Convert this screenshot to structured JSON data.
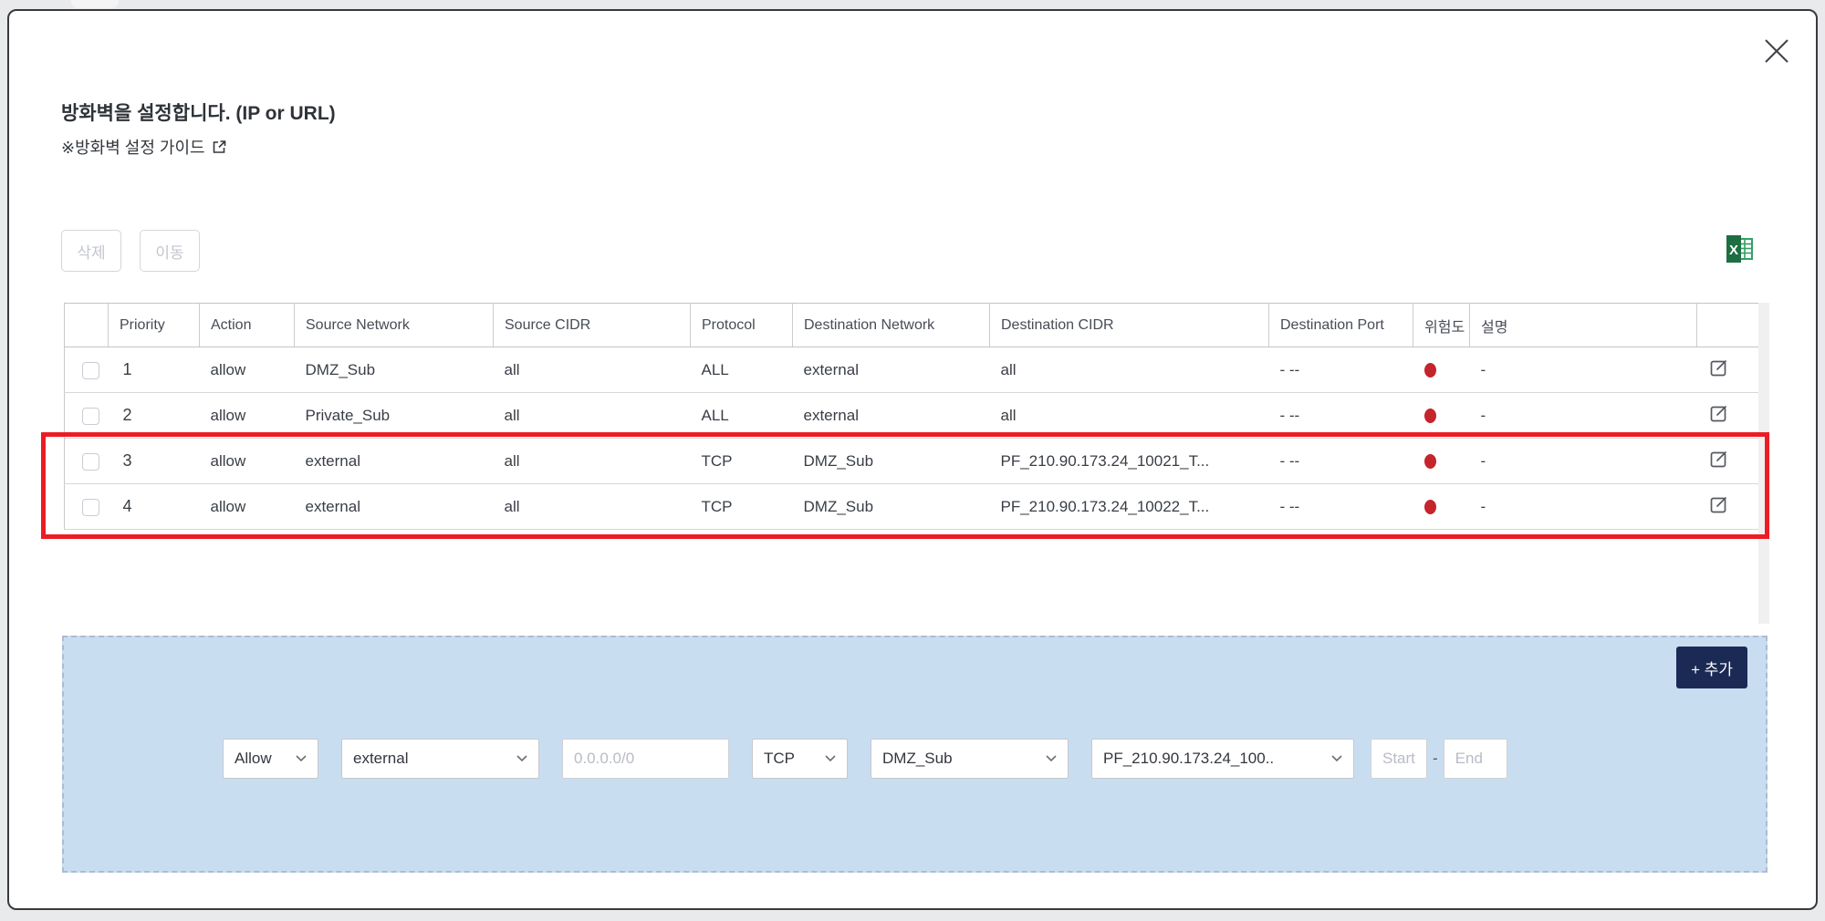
{
  "modal": {
    "title": "방화벽을 설정합니다. (IP or URL)",
    "guide_link": "※방화벽 설정 가이드"
  },
  "toolbar": {
    "delete_label": "삭제",
    "move_label": "이동"
  },
  "table": {
    "columns": [
      "Priority",
      "Action",
      "Source Network",
      "Source CIDR",
      "Protocol",
      "Destination Network",
      "Destination CIDR",
      "Destination Port",
      "위험도",
      "설명"
    ],
    "rows": [
      {
        "priority": "1",
        "action": "allow",
        "source_network": "DMZ_Sub",
        "source_cidr": "all",
        "protocol": "ALL",
        "destination_network": "external",
        "destination_cidr": "all",
        "destination_port": "- --",
        "risk": "red-dot",
        "description": "-"
      },
      {
        "priority": "2",
        "action": "allow",
        "source_network": "Private_Sub",
        "source_cidr": "all",
        "protocol": "ALL",
        "destination_network": "external",
        "destination_cidr": "all",
        "destination_port": "- --",
        "risk": "red-dot",
        "description": "-"
      },
      {
        "priority": "3",
        "action": "allow",
        "source_network": "external",
        "source_cidr": "all",
        "protocol": "TCP",
        "destination_network": "DMZ_Sub",
        "destination_cidr": "PF_210.90.173.24_10021_T...",
        "destination_port": "- --",
        "risk": "red-dot",
        "description": "-"
      },
      {
        "priority": "4",
        "action": "allow",
        "source_network": "external",
        "source_cidr": "all",
        "protocol": "TCP",
        "destination_network": "DMZ_Sub",
        "destination_cidr": "PF_210.90.173.24_10022_T...",
        "destination_port": "- --",
        "risk": "red-dot",
        "description": "-"
      }
    ],
    "highlighted_priorities": [
      "3",
      "4"
    ]
  },
  "add_form": {
    "action_value": "Allow",
    "source_network_value": "external",
    "source_cidr_placeholder": "0.0.0.0/0",
    "protocol_value": "TCP",
    "destination_network_value": "DMZ_Sub",
    "destination_cidr_value": "PF_210.90.173.24_100..",
    "port_start_placeholder": "Start",
    "port_separator": "-",
    "port_end_placeholder": "End",
    "add_button_label": "+ 추가"
  },
  "icons": {
    "close": "close-icon",
    "guide": "external-link-icon",
    "excel": "excel-export-icon",
    "edit": "edit-icon",
    "select": "chevron-down-icon",
    "risk": "risk-dot"
  },
  "colors": {
    "highlight_red": "#ec1c24",
    "risk_red": "#c5242c",
    "panel_blue": "#c9ddf1",
    "add_button_navy": "#1b2a55",
    "excel_green": "#1d6f42"
  }
}
